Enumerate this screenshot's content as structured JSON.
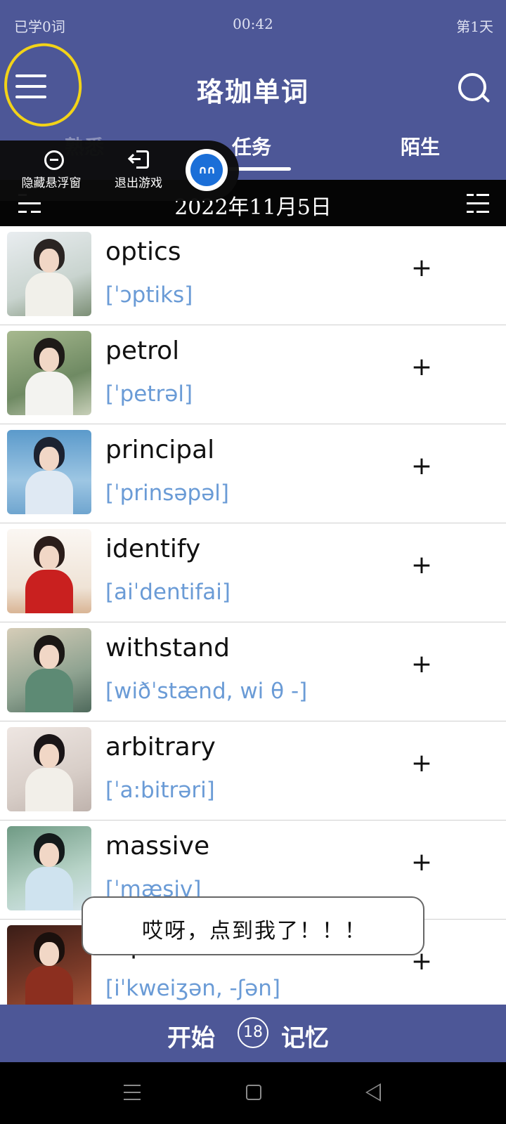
{
  "status": {
    "learned": "已学0词",
    "time": "00:42",
    "day": "第1天"
  },
  "header": {
    "title": "珞珈单词"
  },
  "tabs": [
    {
      "label": "熟悉"
    },
    {
      "label": "任务",
      "active": true
    },
    {
      "label": "陌生"
    }
  ],
  "date": "2022年11月5日",
  "float_menu": {
    "hide_label": "隐藏悬浮窗",
    "exit_label": "退出游戏"
  },
  "words": [
    {
      "word": "optics",
      "phonetic": "[ˈɔptiks]",
      "add": "+"
    },
    {
      "word": "petrol",
      "phonetic": "[ˈpetrəl]",
      "add": "+"
    },
    {
      "word": "principal",
      "phonetic": "[ˈprinsəpəl]",
      "add": "+"
    },
    {
      "word": "identify",
      "phonetic": "[aiˈdentifai]",
      "add": "+"
    },
    {
      "word": "withstand",
      "phonetic": "[wiðˈstænd, wi θ -]",
      "add": "+"
    },
    {
      "word": "arbitrary",
      "phonetic": "[ˈa:bitrəri]",
      "add": "+"
    },
    {
      "word": "massive",
      "phonetic": "[ˈmæsiv]",
      "add": "+"
    },
    {
      "word": "equation",
      "phonetic": "[iˈkweiʒən, -ʃən]",
      "add": "+"
    }
  ],
  "toast": "哎呀，点到我了！！！",
  "start_bar": {
    "left": "开始",
    "count": "18",
    "right": "记忆"
  },
  "colors": {
    "primary": "#4d5797",
    "phonetic": "#6a9bd6",
    "highlight_circle": "#f2d318"
  },
  "icons": {
    "menu": "hamburger-icon",
    "search": "search-icon",
    "filter": "dash-list-icon",
    "list": "list-icon"
  }
}
